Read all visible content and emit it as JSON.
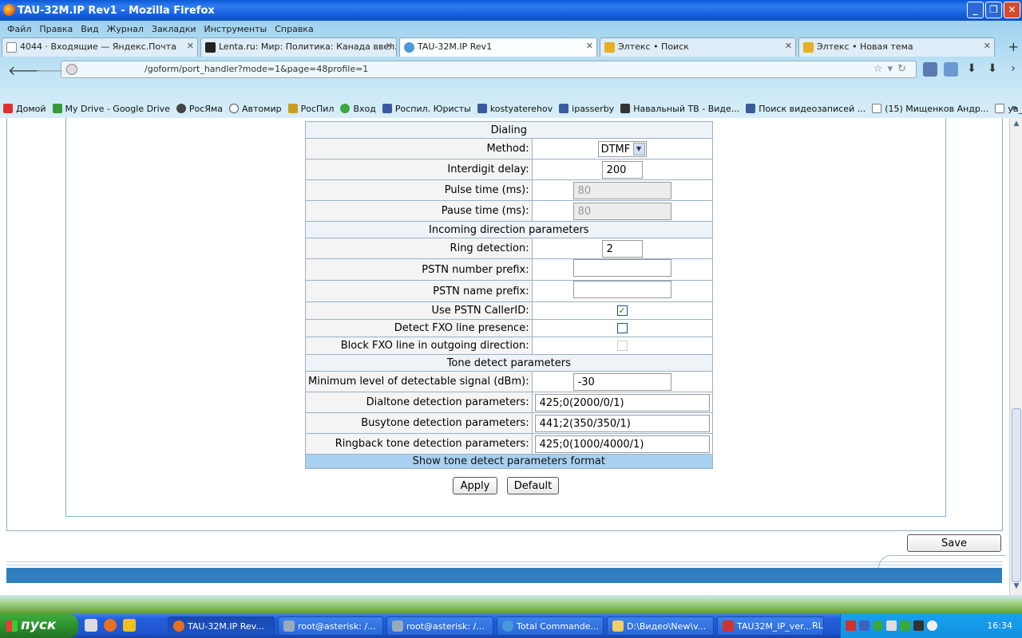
{
  "window": {
    "title": "TAU-32M.IP Rev1 - Mozilla Firefox"
  },
  "menu": [
    "Файл",
    "Правка",
    "Вид",
    "Журнал",
    "Закладки",
    "Инструменты",
    "Справка"
  ],
  "tabs": [
    {
      "label": "4044 · Входящие — Яндекс.Почта"
    },
    {
      "label": "Lenta.ru: Мир: Политика: Канада ввел..."
    },
    {
      "label": "TAU-32M.IP Rev1"
    },
    {
      "label": "Элтекс • Поиск"
    },
    {
      "label": "Элтекс • Новая тема"
    }
  ],
  "url": "/goform/port_handler?mode=1&page=48profile=1",
  "bookmarks": [
    "Домой",
    "My Drive - Google Drive",
    "РосЯма",
    "Автомир",
    "РосПил",
    "Вход",
    "Роспил. Юристы",
    "kostyaterehov",
    "ipasserby",
    "Навальный ТВ - Виде...",
    "Поиск видеозаписей ...",
    "(15) Мищенков Андр...",
    "ya_vlasenko"
  ],
  "form": {
    "dialing_header": "Dialing",
    "method_label": "Method:",
    "method_value": "DTMF",
    "interdigit_label": "Interdigit delay:",
    "interdigit_value": "200",
    "pulse_label": "Pulse time (ms):",
    "pulse_value": "80",
    "pause_label": "Pause time (ms):",
    "pause_value": "80",
    "incoming_header": "Incoming direction parameters",
    "ring_label": "Ring detection:",
    "ring_value": "2",
    "pstn_number_label": "PSTN number prefix:",
    "pstn_number_value": "",
    "pstn_name_label": "PSTN name prefix:",
    "pstn_name_value": "",
    "callerid_label": "Use PSTN CallerID:",
    "callerid_checked": true,
    "detect_fxo_label": "Detect FXO line presence:",
    "detect_fxo_checked": false,
    "block_fxo_label": "Block FXO line in outgoing direction:",
    "block_fxo_checked": false,
    "tone_header": "Tone detect parameters",
    "min_level_label": "Minimum level of detectable signal (dBm):",
    "min_level_value": "-30",
    "dialtone_label": "Dialtone detection parameters:",
    "dialtone_value": "425;0(2000/0/1)",
    "busytone_label": "Busytone detection parameters:",
    "busytone_value": "441;2(350/350/1)",
    "ringback_label": "Ringback tone detection parameters:",
    "ringback_value": "425;0(1000/4000/1)",
    "show_format_link": "Show tone detect parameters format",
    "apply_label": "Apply",
    "default_label": "Default",
    "save_label": "Save"
  },
  "taskbar": {
    "start_label": "пуск",
    "tasks": [
      "TAU-32M.IP Rev...",
      "root@asterisk: /...",
      "root@asterisk: /...",
      "Total Commande...",
      "D:\\Видео\\New\\v...",
      "TAU32M_IP_ver..."
    ],
    "lang": "RL",
    "clock": "16:34"
  },
  "colors": {
    "accent": "#2e7ec0",
    "header_bg": "#eef3f8",
    "link_row": "#a8d0f0"
  }
}
